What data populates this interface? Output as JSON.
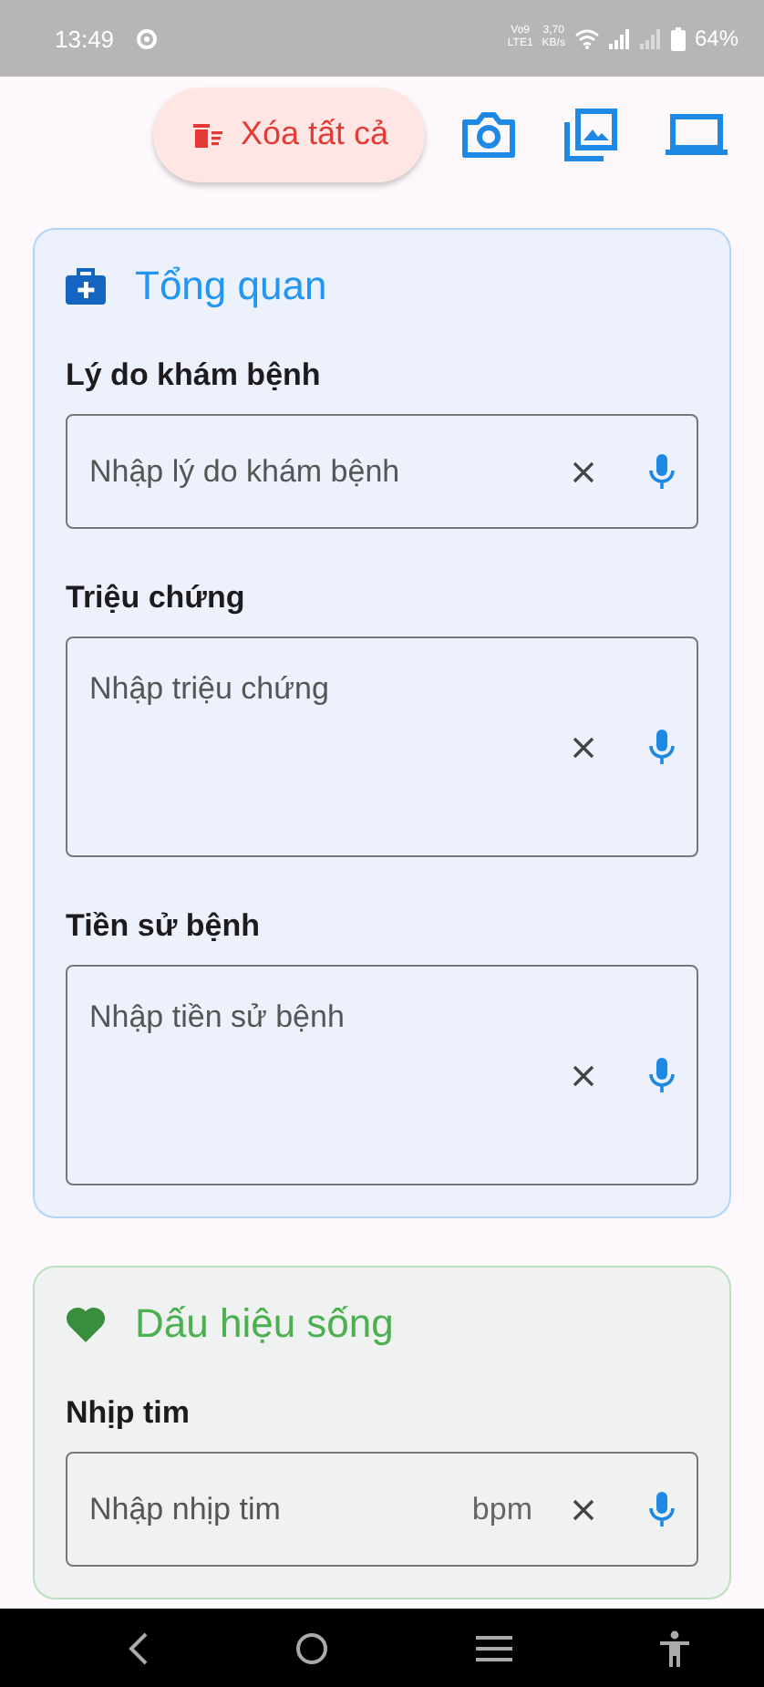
{
  "status_bar": {
    "time": "13:49",
    "net_type_top": "Vo9",
    "net_type_bottom": "LTE1",
    "speed_value": "3,70",
    "speed_unit": "KB/s",
    "battery": "64%"
  },
  "toolbar": {
    "clear_button": "Xóa tất cả"
  },
  "sections": [
    {
      "title": "Tổng quan",
      "kind": "medkit",
      "color": "#2196f3",
      "fields": [
        {
          "label": "Lý do khám bệnh",
          "placeholder": "Nhập lý do khám bệnh",
          "kind": "single"
        },
        {
          "label": "Triệu chứng",
          "placeholder": "Nhập triệu chứng",
          "kind": "multiline"
        },
        {
          "label": "Tiền sử bệnh",
          "placeholder": "Nhập tiền sử bệnh",
          "kind": "multiline"
        }
      ]
    },
    {
      "title": "Dấu hiệu sống",
      "kind": "heart",
      "color": "#4caf50",
      "fields": [
        {
          "label": "Nhịp tim",
          "placeholder": "Nhập nhịp tim",
          "kind": "single",
          "suffix": "bpm"
        }
      ]
    }
  ]
}
